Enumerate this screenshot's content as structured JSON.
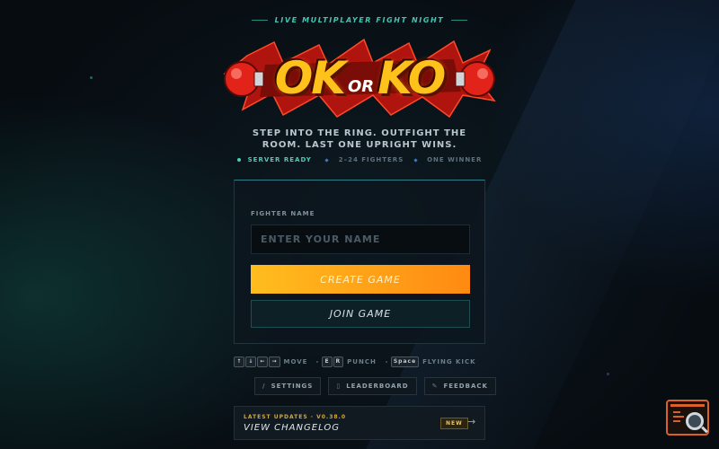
{
  "header": {
    "tagline": "LIVE MULTIPLAYER FIGHT NIGHT"
  },
  "logo": {
    "ok": "OK",
    "or": "OR",
    "ko": "KO"
  },
  "hero": {
    "line1": "STEP INTO THE RING. OUTFIGHT THE",
    "line2": "ROOM. LAST ONE UPRIGHT WINS."
  },
  "status": {
    "server": "SERVER READY",
    "fighters": "2–24 FIGHTERS",
    "winner": "ONE WINNER"
  },
  "form": {
    "name_label": "FIGHTER NAME",
    "name_placeholder": "ENTER YOUR NAME",
    "name_value": "",
    "create_label": "CREATE GAME",
    "join_label": "JOIN GAME"
  },
  "controls": {
    "move_keys": [
      "↑",
      "↓",
      "←",
      "→"
    ],
    "move_label": "MOVE",
    "punch_keys": [
      "E",
      "R"
    ],
    "punch_label": "PUNCH",
    "kick_key": "Space",
    "kick_label": "FLYING KICK"
  },
  "menu": {
    "settings": "SETTINGS",
    "settings_icon": "/",
    "leaderboard": "LEADERBOARD",
    "leaderboard_icon": "▯",
    "feedback": "FEEDBACK",
    "feedback_icon": "✎"
  },
  "changelog": {
    "kicker": "LATEST UPDATES · V0.38.0",
    "title": "VIEW CHANGELOG",
    "badge": "NEW",
    "arrow": "→"
  },
  "colors": {
    "accent_teal": "#43d1b8",
    "button_orange_start": "#ffbd1e",
    "button_orange_end": "#ff8a12",
    "logo_yellow": "#ffc21a",
    "logo_red": "#d81c1c"
  }
}
